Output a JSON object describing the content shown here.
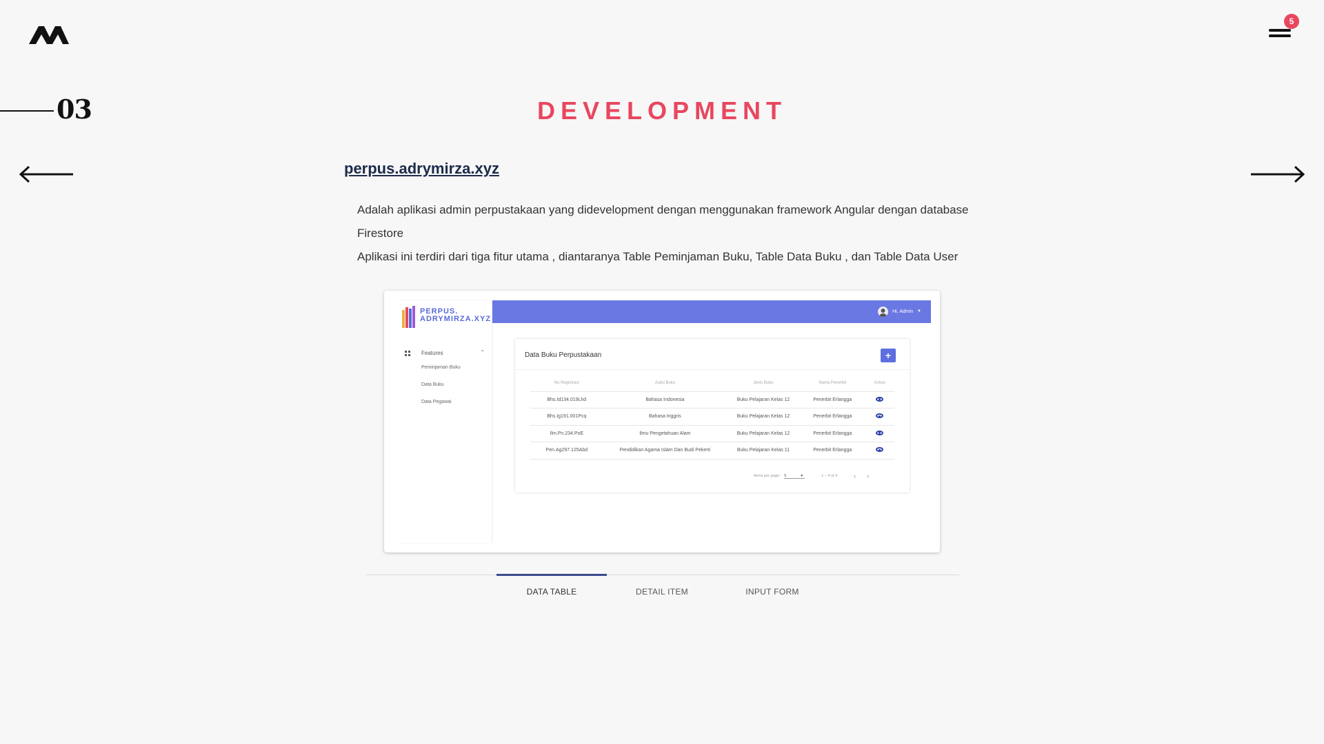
{
  "header": {
    "logo_text": "AM",
    "notification_count": "5"
  },
  "section": {
    "number": "03",
    "title": "DEVELOPMENT"
  },
  "project": {
    "link_text": "perpus.adrymirza.xyz",
    "description_line1": "Adalah aplikasi admin perpustakaan yang didevelopment dengan menggunakan framework Angular dengan database",
    "description_line2": "Firestore",
    "description_line3": "Aplikasi ini terdiri dari tiga fitur utama , diantaranya Table Peminjaman Buku, Table Data Buku , dan Table Data User"
  },
  "screenshot": {
    "brand_line1": "PERPUS.",
    "brand_line2": "ADRYMIRZA.XYZ",
    "sidebar_group": "Features",
    "sidebar_items": [
      "Peminjaman Buku",
      "Data Buku",
      "Data Pegawai"
    ],
    "user_greeting": "Hi, Admin",
    "card_title": "Data Buku Perpustakaan",
    "add_label": "+",
    "columns": [
      "No Registrasi",
      "Judul Buku",
      "Jenis Buku",
      "Nama Penerbit",
      "Action"
    ],
    "rows": [
      [
        "Bhs.Id134.019Lhd",
        "Bahasa Indonesia",
        "Buku Pelajaran Kelas 12",
        "Penerbit Erlangga"
      ],
      [
        "Bhs.Ig191.001Pcq",
        "Bahasa Inggris",
        "Buku Pelajaran Kelas 12",
        "Penerbit Erlangga"
      ],
      [
        "Ilm.Pn.234.PoE",
        "Ilmu Pengetahuan Alam",
        "Buku Pelajaran Kelas 12",
        "Penerbit Erlangga"
      ],
      [
        "Pen.Ag297.125Abd",
        "Pendidikan Agama Islam Dan Budi Pekerti",
        "Buku Pelajaran Kelas 11",
        "Penerbit Erlangga"
      ]
    ],
    "pager_label": "Items per page:",
    "pager_size": "5",
    "pager_range": "1 – 4 of 4"
  },
  "tabs": [
    {
      "label": "DATA TABLE",
      "active": true
    },
    {
      "label": "DETAIL ITEM",
      "active": false
    },
    {
      "label": "INPUT FORM",
      "active": false
    }
  ],
  "colors": {
    "accent": "#e8475f",
    "topbar": "#6a78e3",
    "tab_indicator": "#3a4a8c"
  }
}
